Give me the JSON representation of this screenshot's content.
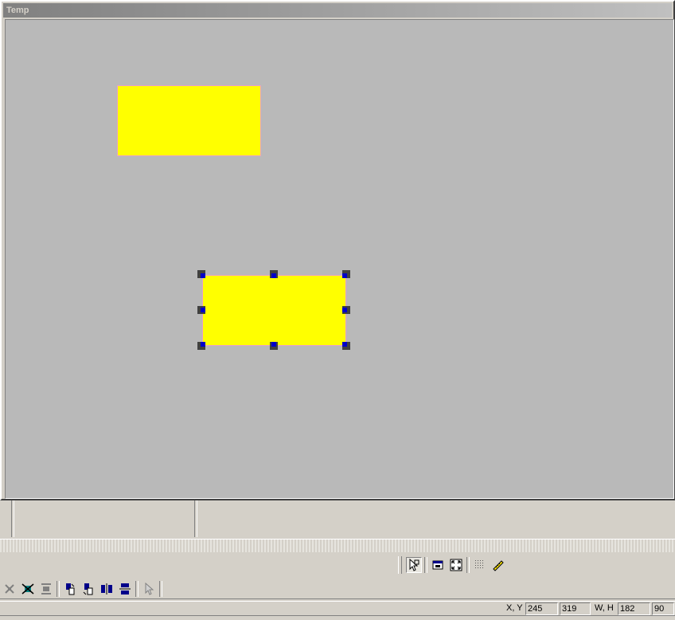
{
  "window": {
    "title": "Temp"
  },
  "canvas": {
    "background": "#b9b9b9",
    "shape_fill": "#ffff00",
    "handle_color": "#404040",
    "handle_accent": "#0000c8"
  },
  "shapes": [
    {
      "name": "rectangle-1",
      "selected": false
    },
    {
      "name": "rectangle-2",
      "selected": true
    }
  ],
  "toolbar_top": {
    "icons": [
      "select-pointer-icon",
      "fit-window-icon",
      "fullscreen-icon",
      "grid-icon",
      "ruler-icon"
    ]
  },
  "toolbar_bottom": {
    "icons": [
      "align-center-icon",
      "distribute-horizontal-icon",
      "distribute-vertical-icon",
      "rotate-right-icon",
      "rotate-left-icon",
      "flip-horizontal-icon",
      "flip-vertical-icon",
      "pointer-icon"
    ]
  },
  "status": {
    "xy_label": "X, Y",
    "x": "245",
    "y": "319",
    "wh_label": "W, H",
    "w": "182",
    "h": "90"
  }
}
